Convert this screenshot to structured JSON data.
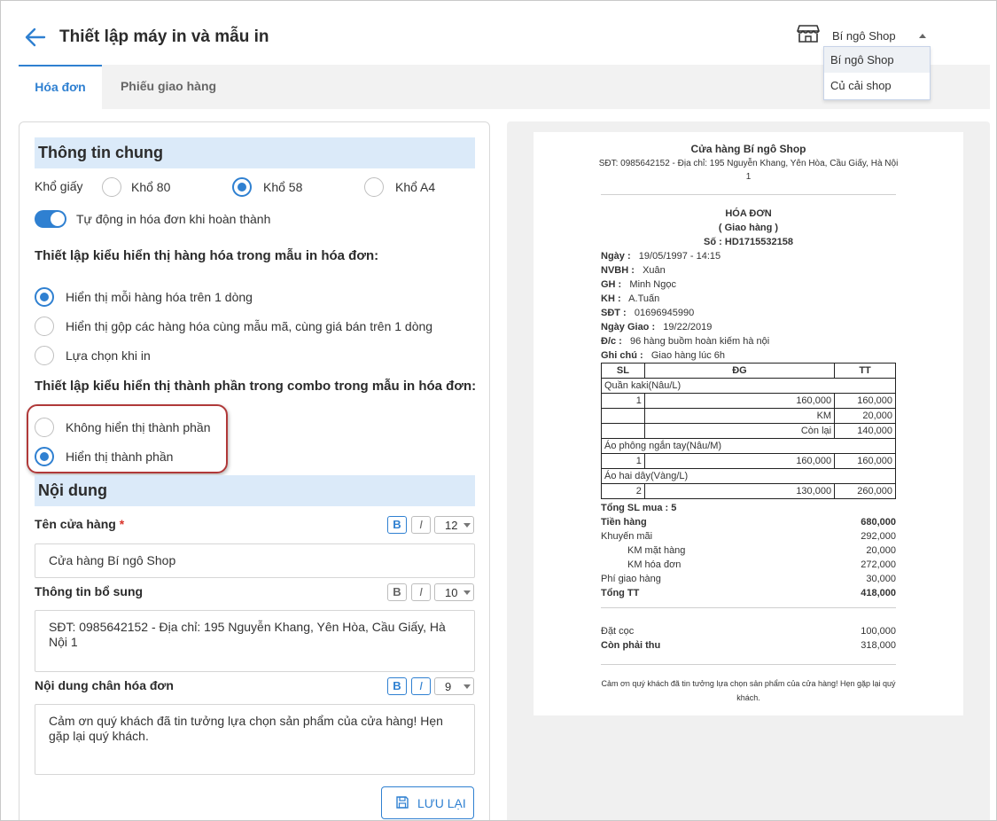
{
  "header": {
    "title": "Thiết lập máy in và mẫu in",
    "shop_selected": "Bí ngô Shop",
    "shop_options": [
      "Bí ngô Shop",
      "Củ cải shop"
    ]
  },
  "tabs": [
    {
      "label": "Hóa đơn",
      "active": true
    },
    {
      "label": "Phiếu giao hàng",
      "active": false
    }
  ],
  "general": {
    "title": "Thông tin chung",
    "paper_label": "Khổ giấy",
    "paper_options": [
      {
        "label": "Khổ 80",
        "checked": false
      },
      {
        "label": "Khổ 58",
        "checked": true
      },
      {
        "label": "Khổ A4",
        "checked": false
      }
    ],
    "auto_print_label": "Tự động in hóa đơn khi hoàn thành",
    "auto_print_on": true,
    "goods_display_title": "Thiết lập kiểu hiển thị hàng hóa trong mẫu in hóa đơn:",
    "goods_display_options": [
      {
        "label": "Hiển thị mỗi hàng hóa trên 1 dòng",
        "checked": true
      },
      {
        "label": "Hiển thị gộp các hàng hóa cùng mẫu mã, cùng giá bán trên 1 dòng",
        "checked": false
      },
      {
        "label": "Lựa chọn khi in",
        "checked": false
      }
    ],
    "combo_display_title": "Thiết lập kiểu hiển thị thành phần trong combo trong mẫu in hóa đơn:",
    "combo_display_options": [
      {
        "label": "Không hiển thị thành phần",
        "checked": false
      },
      {
        "label": "Hiển thị thành phần",
        "checked": true
      }
    ]
  },
  "content": {
    "title": "Nội dung",
    "store_name_label": "Tên cửa hàng",
    "required_mark": "*",
    "store_name_value": "Cửa hàng Bí ngô Shop",
    "store_name_bold": true,
    "store_name_italic": false,
    "store_name_size": "12",
    "extra_info_label": "Thông tin bổ sung",
    "extra_info_value": "SĐT: 0985642152 - Địa chỉ: 195 Nguyễn Khang, Yên Hòa, Cầu Giấy, Hà Nội 1",
    "extra_info_size": "10",
    "footer_label": "Nội dung chân hóa đơn",
    "footer_value": "Cảm ơn quý khách đã tin tưởng lựa chọn sản phẩm của cửa hàng! Hẹn gặp lại quý khách.",
    "footer_size": "9",
    "bold_label": "B",
    "italic_label": "I",
    "save_label": "LƯU LẠI"
  },
  "preview": {
    "store_name": "Cửa hàng Bí ngô Shop",
    "store_info_line1": "SĐT: 0985642152 - Địa chỉ: 195 Nguyễn Khang, Yên Hòa, Cầu Giấy, Hà Nội",
    "store_info_line2": "1",
    "doc_title": "HÓA ĐƠN",
    "doc_subtitle": "( Giao hàng )",
    "doc_number": "Số : HD1715532158",
    "fields": [
      {
        "label": "Ngày :",
        "value": "19/05/1997 - 14:15"
      },
      {
        "label": "NVBH :",
        "value": "Xuân"
      },
      {
        "label": "GH :",
        "value": "Minh Ngọc"
      },
      {
        "label": "KH :",
        "value": "A.Tuấn"
      },
      {
        "label": "SĐT :",
        "value": "01696945990"
      },
      {
        "label": "Ngày Giao :",
        "value": "19/22/2019"
      },
      {
        "label": "Đ/c :",
        "value": "96 hàng buồm hoàn kiếm hà nội"
      },
      {
        "label": "Ghi chú :",
        "value": "Giao hàng lúc 6h"
      }
    ],
    "table_headers": [
      "SL",
      "ĐG",
      "TT"
    ],
    "items": [
      {
        "name": "Quần kaki(Nâu/L)",
        "qty": "1",
        "price": "160,000",
        "total": "160,000",
        "promo_label": "KM",
        "promo": "20,000",
        "remain_label": "Còn lại",
        "remain": "140,000"
      },
      {
        "name": "Áo phông ngắn tay(Nâu/M)",
        "qty": "1",
        "price": "160,000",
        "total": "160,000"
      },
      {
        "name": "Áo hai dây(Vàng/L)",
        "qty": "2",
        "price": "130,000",
        "total": "260,000"
      }
    ],
    "total_qty": "Tổng SL mua : 5",
    "summary": [
      {
        "label": "Tiền hàng",
        "value": "680,000",
        "bold": true,
        "indent": false
      },
      {
        "label": "Khuyến mãi",
        "value": "292,000",
        "bold": false,
        "indent": false
      },
      {
        "label": "KM mặt hàng",
        "value": "20,000",
        "bold": false,
        "indent": true
      },
      {
        "label": "KM hóa đơn",
        "value": "272,000",
        "bold": false,
        "indent": true
      },
      {
        "label": "Phí giao hàng",
        "value": "30,000",
        "bold": false,
        "indent": false
      },
      {
        "label": "Tổng TT",
        "value": "418,000",
        "bold": true,
        "indent": false
      }
    ],
    "deposit": [
      {
        "label": "Đặt cọc",
        "value": "100,000",
        "bold": false
      },
      {
        "label": "Còn phải thu",
        "value": "318,000",
        "bold": true
      }
    ],
    "footer_line1": "Cảm ơn quý khách đã tin tưởng lựa chọn sản phẩm của cửa hàng! Hẹn gặp lại quý",
    "footer_line2": "khách."
  },
  "colors": {
    "accent": "#2f80d1",
    "section_bg": "#dbeaf9",
    "highlight": "#b03939",
    "required": "#d9342b"
  },
  "icons": [
    "arrow-left-icon",
    "store-icon",
    "caret-up-icon",
    "save-icon",
    "caret-down-icon"
  ]
}
